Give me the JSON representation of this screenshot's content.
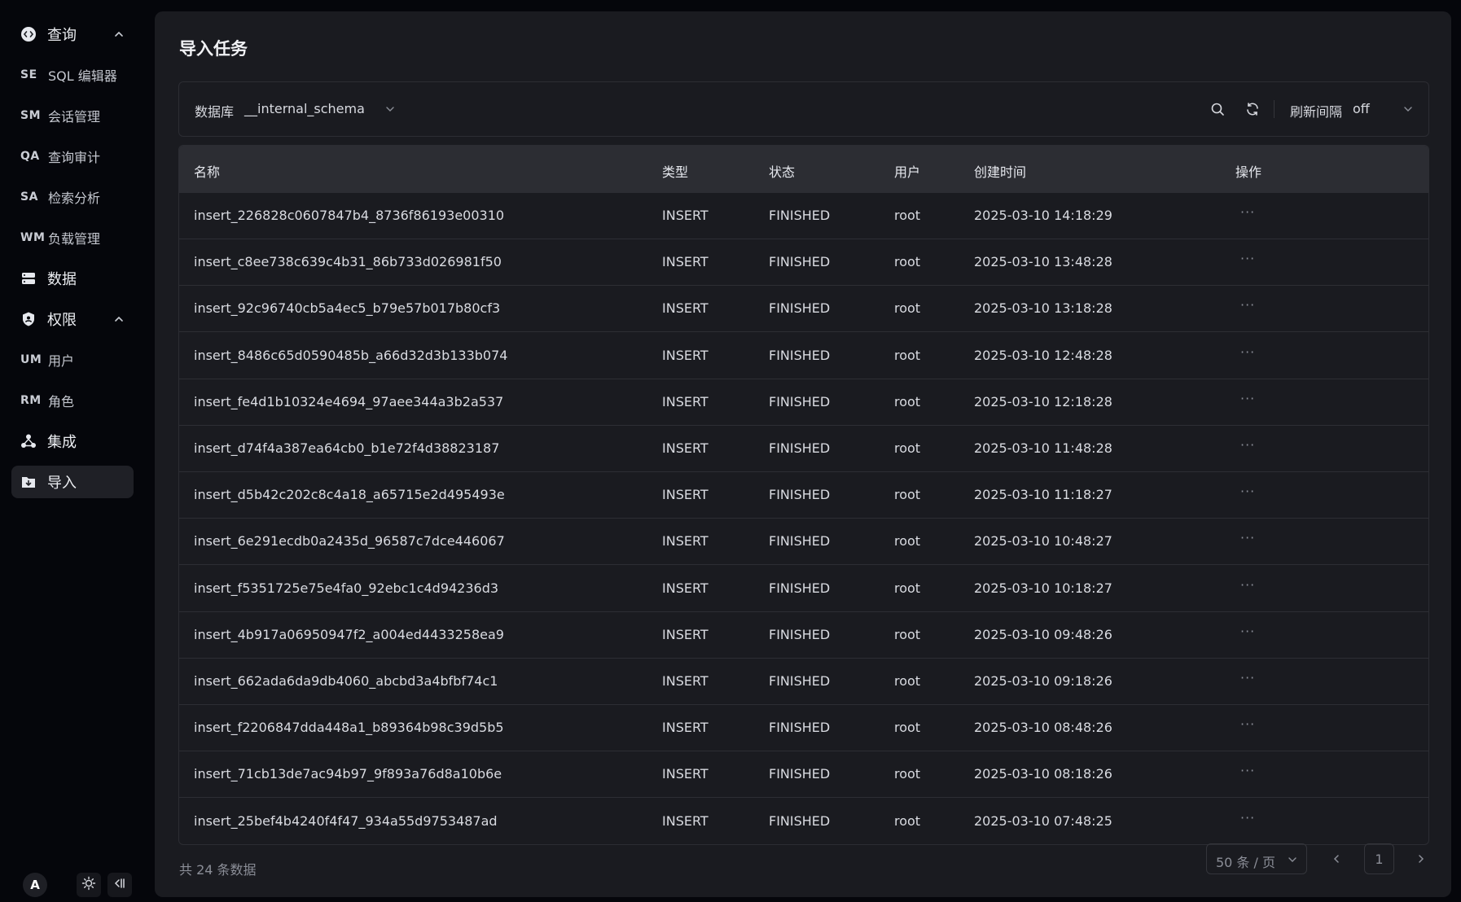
{
  "sidebar": {
    "items": [
      {
        "label": "查询",
        "icon": "code-circle-icon"
      },
      {
        "abbr": "SE",
        "label": "SQL 编辑器"
      },
      {
        "abbr": "SM",
        "label": "会话管理"
      },
      {
        "abbr": "QA",
        "label": "查询审计"
      },
      {
        "abbr": "SA",
        "label": "检索分析"
      },
      {
        "abbr": "WM",
        "label": "负载管理"
      },
      {
        "label": "数据",
        "icon": "database-icon"
      },
      {
        "label": "权限",
        "icon": "shield-icon"
      },
      {
        "abbr": "UM",
        "label": "用户"
      },
      {
        "abbr": "RM",
        "label": "角色"
      },
      {
        "label": "集成",
        "icon": "integration-icon"
      },
      {
        "label": "导入",
        "icon": "import-folder-icon"
      }
    ],
    "avatar": "A"
  },
  "page": {
    "title": "导入任务"
  },
  "toolbar": {
    "db_label": "数据库",
    "db_value": "__internal_schema",
    "refresh_label": "刷新间隔",
    "refresh_value": "off"
  },
  "table": {
    "columns": [
      "名称",
      "类型",
      "状态",
      "用户",
      "创建时间",
      "操作"
    ],
    "rows": [
      {
        "name": "insert_226828c0607847b4_8736f86193e00310",
        "type": "INSERT",
        "status": "FINISHED",
        "user": "root",
        "created": "2025-03-10 14:18:29"
      },
      {
        "name": "insert_c8ee738c639c4b31_86b733d026981f50",
        "type": "INSERT",
        "status": "FINISHED",
        "user": "root",
        "created": "2025-03-10 13:48:28"
      },
      {
        "name": "insert_92c96740cb5a4ec5_b79e57b017b80cf3",
        "type": "INSERT",
        "status": "FINISHED",
        "user": "root",
        "created": "2025-03-10 13:18:28"
      },
      {
        "name": "insert_8486c65d0590485b_a66d32d3b133b074",
        "type": "INSERT",
        "status": "FINISHED",
        "user": "root",
        "created": "2025-03-10 12:48:28"
      },
      {
        "name": "insert_fe4d1b10324e4694_97aee344a3b2a537",
        "type": "INSERT",
        "status": "FINISHED",
        "user": "root",
        "created": "2025-03-10 12:18:28"
      },
      {
        "name": "insert_d74f4a387ea64cb0_b1e72f4d38823187",
        "type": "INSERT",
        "status": "FINISHED",
        "user": "root",
        "created": "2025-03-10 11:48:28"
      },
      {
        "name": "insert_d5b42c202c8c4a18_a65715e2d495493e",
        "type": "INSERT",
        "status": "FINISHED",
        "user": "root",
        "created": "2025-03-10 11:18:27"
      },
      {
        "name": "insert_6e291ecdb0a2435d_96587c7dce446067",
        "type": "INSERT",
        "status": "FINISHED",
        "user": "root",
        "created": "2025-03-10 10:48:27"
      },
      {
        "name": "insert_f5351725e75e4fa0_92ebc1c4d94236d3",
        "type": "INSERT",
        "status": "FINISHED",
        "user": "root",
        "created": "2025-03-10 10:18:27"
      },
      {
        "name": "insert_4b917a06950947f2_a004ed4433258ea9",
        "type": "INSERT",
        "status": "FINISHED",
        "user": "root",
        "created": "2025-03-10 09:48:26"
      },
      {
        "name": "insert_662ada6da9db4060_abcbd3a4bfbf74c1",
        "type": "INSERT",
        "status": "FINISHED",
        "user": "root",
        "created": "2025-03-10 09:18:26"
      },
      {
        "name": "insert_f2206847dda448a1_b89364b98c39d5b5",
        "type": "INSERT",
        "status": "FINISHED",
        "user": "root",
        "created": "2025-03-10 08:48:26"
      },
      {
        "name": "insert_71cb13de7ac94b97_9f893a76d8a10b6e",
        "type": "INSERT",
        "status": "FINISHED",
        "user": "root",
        "created": "2025-03-10 08:18:26"
      },
      {
        "name": "insert_25bef4b4240f4f47_934a55d9753487ad",
        "type": "INSERT",
        "status": "FINISHED",
        "user": "root",
        "created": "2025-03-10 07:48:25"
      }
    ],
    "more_label": "···"
  },
  "footer": {
    "total": "共 24 条数据",
    "page_size": "50 条 / 页",
    "current_page": "1"
  }
}
